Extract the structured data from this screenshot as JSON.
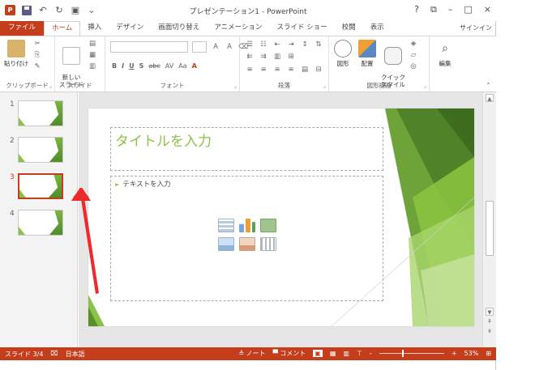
{
  "window": {
    "title": "プレゼンテーション1 - PowerPoint",
    "controls": [
      "?",
      "⧉",
      "–",
      "□",
      "×"
    ]
  },
  "tabs": [
    {
      "label": "ファイル",
      "kind": "file"
    },
    {
      "label": "ホーム",
      "kind": "active"
    },
    {
      "label": "挿入"
    },
    {
      "label": "デザイン"
    },
    {
      "label": "画面切り替え"
    },
    {
      "label": "アニメーション"
    },
    {
      "label": "スライド ショー"
    },
    {
      "label": "校閲"
    },
    {
      "label": "表示"
    }
  ],
  "signin": "サインイン",
  "ribbon": {
    "clipboard": {
      "label": "クリップボード",
      "paste": "貼り付け"
    },
    "slides": {
      "label": "スライド",
      "new_slide": "新しい\nスライド"
    },
    "font": {
      "label": "フォント",
      "row2": [
        "B",
        "I",
        "U",
        "S",
        "abc",
        "AV",
        "Aa",
        "A"
      ]
    },
    "paragraph": {
      "label": "段落"
    },
    "drawing": {
      "label": "図形描画",
      "shapes": "図形",
      "arrange": "配置",
      "quick_styles": "クイック\nスタイル"
    },
    "editing": {
      "label": "編集"
    }
  },
  "thumbnails": {
    "items": [
      {
        "num": "1",
        "selected": false
      },
      {
        "num": "2",
        "selected": false
      },
      {
        "num": "3",
        "selected": true
      },
      {
        "num": "4",
        "selected": false
      }
    ]
  },
  "slide": {
    "title_placeholder": "タイトルを入力",
    "body_placeholder": "テキストを入力"
  },
  "status": {
    "slide": "スライド 3/4",
    "lang": "日本語",
    "notes": "ノート",
    "comments": "コメント",
    "zoom": "53%",
    "zoom_minus": "-",
    "zoom_plus": "+"
  },
  "colors": {
    "accent": "#c43e1c",
    "theme_green": "#8bc34a",
    "annotation_arrow": "#ee2b2b"
  }
}
